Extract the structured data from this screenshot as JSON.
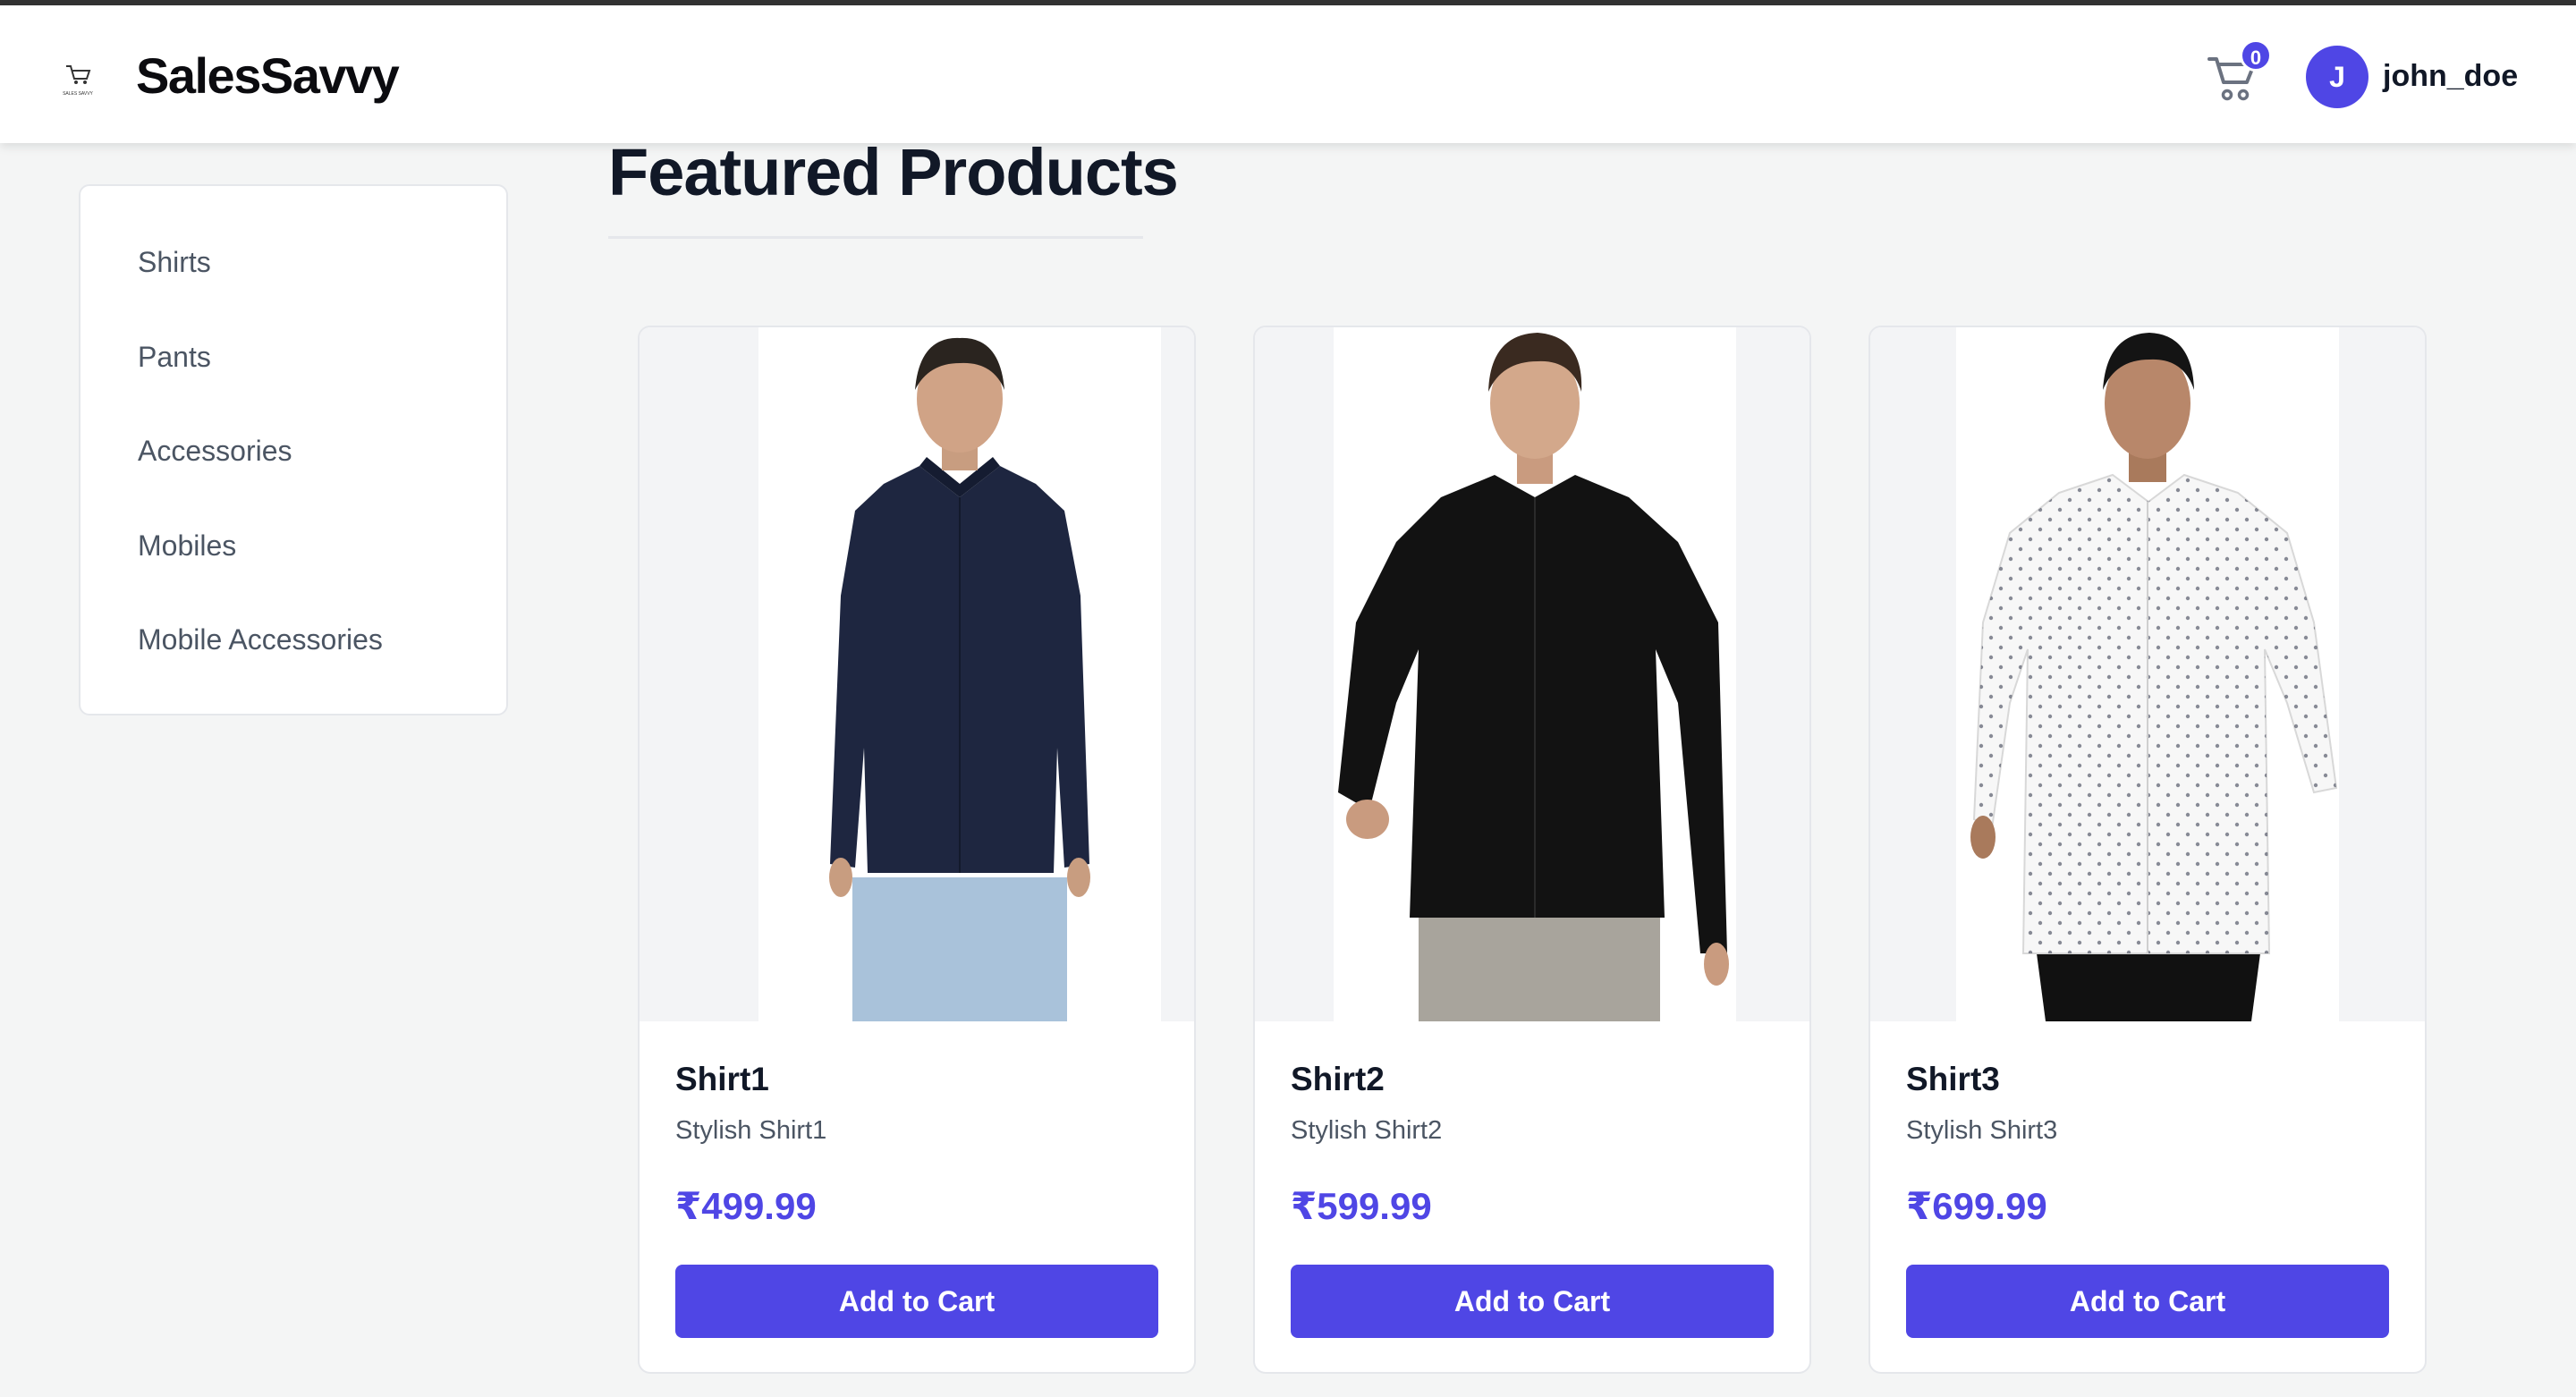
{
  "app": {
    "brand": "SalesSavvy",
    "logo_text": "SALES SAVVY"
  },
  "header": {
    "cart_count": "0",
    "avatar_initial": "J",
    "username": "john_doe"
  },
  "sidebar": {
    "items": [
      {
        "label": "Shirts"
      },
      {
        "label": "Pants"
      },
      {
        "label": "Accessories"
      },
      {
        "label": "Mobiles"
      },
      {
        "label": "Mobile Accessories"
      }
    ]
  },
  "main": {
    "title": "Featured Products",
    "products": [
      {
        "name": "Shirt1",
        "description": "Stylish Shirt1",
        "price": "₹499.99",
        "button": "Add to Cart",
        "shirt_color": "#1e2640"
      },
      {
        "name": "Shirt2",
        "description": "Stylish Shirt2",
        "price": "₹599.99",
        "button": "Add to Cart",
        "shirt_color": "#121212"
      },
      {
        "name": "Shirt3",
        "description": "Stylish Shirt3",
        "price": "₹699.99",
        "button": "Add to Cart",
        "shirt_color": "#f7f7f7"
      }
    ]
  },
  "colors": {
    "accent": "#4f46e5",
    "page_bg": "#f4f5f5"
  },
  "icons": {
    "cart": "shopping-cart-icon",
    "logo": "cart-logo-icon"
  }
}
